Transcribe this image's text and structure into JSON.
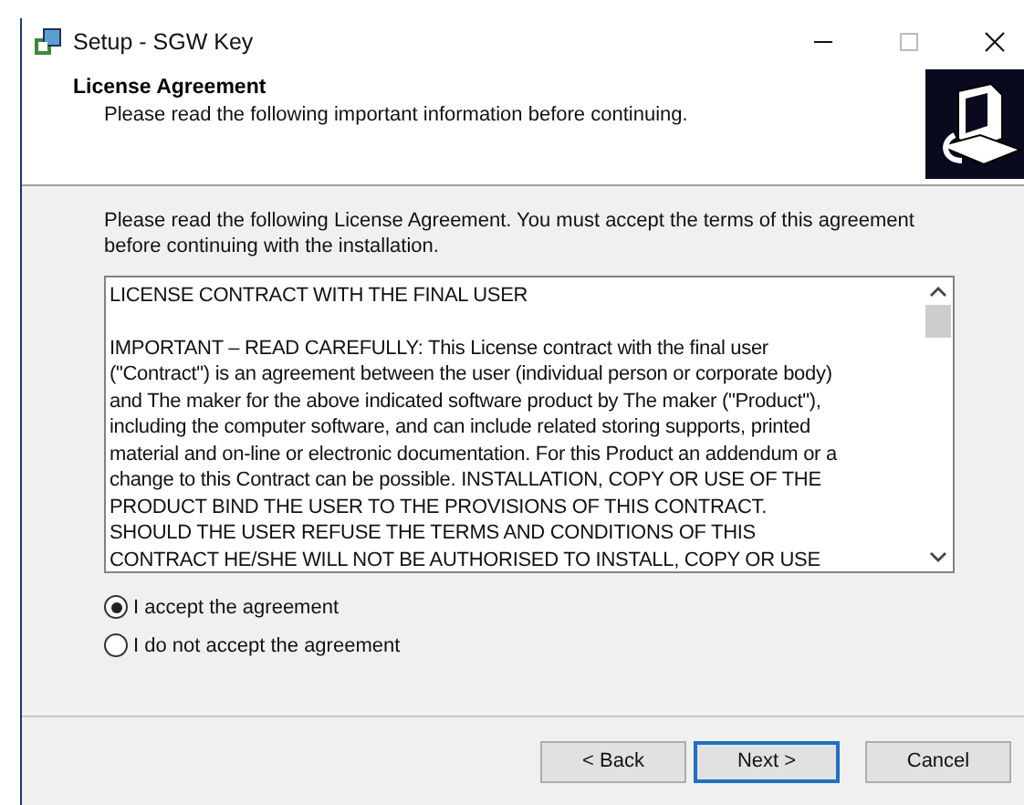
{
  "window": {
    "title": "Setup - SGW Key"
  },
  "header": {
    "title": "License Agreement",
    "subtitle": "Please read the following important information before continuing."
  },
  "intro": "Please read the following License Agreement. You must accept the terms of this agreement before continuing with the installation.",
  "license_text": {
    "paragraphs": [
      [
        "LICENSE CONTRACT WITH THE FINAL USER"
      ],
      [
        "IMPORTANT – READ CAREFULLY: This License contract with the final user",
        "(\"Contract\") is an agreement between the user (individual person or corporate body)",
        "and The maker for the above indicated software product by The maker (\"Product\"),",
        "including the computer software, and can include related storing supports, printed",
        "material and on-line or electronic documentation. For this Product an addendum or a",
        "change to this Contract can be possible. INSTALLATION, COPY OR USE OF THE",
        "PRODUCT BIND THE USER TO THE PROVISIONS OF THIS CONTRACT.",
        "SHOULD THE USER REFUSE THE TERMS AND CONDITIONS OF THIS",
        "CONTRACT HE/SHE WILL NOT BE AUTHORISED TO INSTALL, COPY OR USE"
      ]
    ]
  },
  "options": [
    {
      "label": "I accept the agreement",
      "selected": true
    },
    {
      "label": "I do not accept the agreement",
      "selected": false
    }
  ],
  "buttons": [
    {
      "label": "< Back",
      "default": false
    },
    {
      "label": "Next >",
      "default": true
    },
    {
      "label": "Cancel",
      "default": false
    }
  ]
}
